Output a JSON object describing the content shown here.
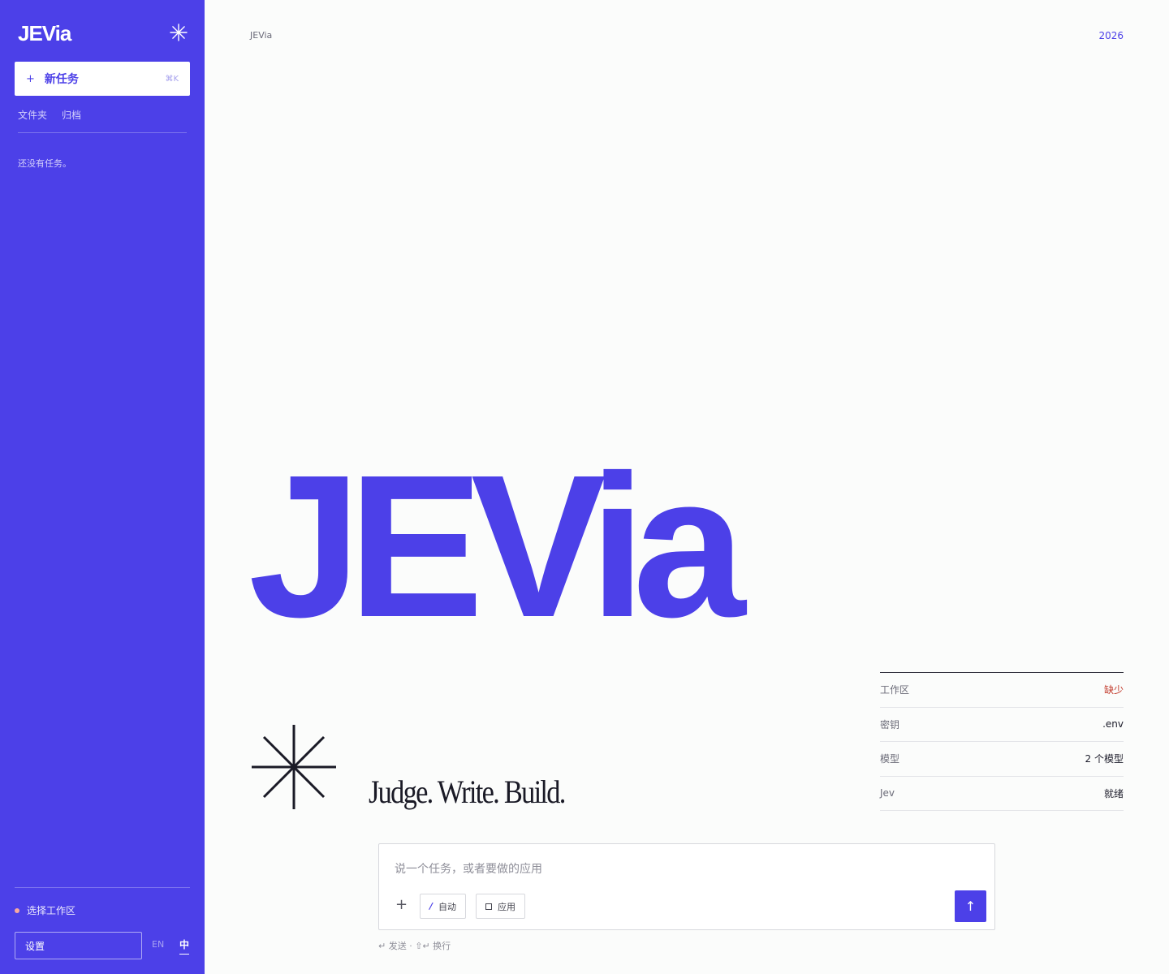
{
  "app": {
    "title": "JEVia",
    "year": "2026"
  },
  "sidebar": {
    "logo": "JEVia",
    "new_task": {
      "plus": "+",
      "label": "新任务",
      "shortcut": "⌘K"
    },
    "tabs": [
      "文件夹",
      "归档"
    ],
    "empty_state": "还没有任务。",
    "workspace_label": "选择工作区",
    "settings_label": "设置",
    "lang_en": "EN",
    "lang_zh": "中"
  },
  "hero": {
    "wordmark": "JEVia",
    "tagline": "Judge. Write. Build."
  },
  "status": [
    {
      "key": "工作区",
      "value": "缺少"
    },
    {
      "key": "密钥",
      "value": ".env"
    },
    {
      "key": "模型",
      "value": "2 个模型"
    },
    {
      "key": "Jev",
      "value": "就绪"
    }
  ],
  "composer": {
    "placeholder": "说一个任务，或者要做的应用",
    "add": "+",
    "mode_auto": "自动",
    "mode_app": "应用",
    "send_icon": "↑",
    "hint": "↵ 发送 · ⇧↵ 换行"
  },
  "colors": {
    "accent": "#4c40e8",
    "missing": "#c23a2b",
    "background": "#fbfcfb"
  },
  "icons": [
    "asterisk-icon",
    "plus-icon",
    "slash-icon",
    "square-icon",
    "arrow-up-icon"
  ]
}
